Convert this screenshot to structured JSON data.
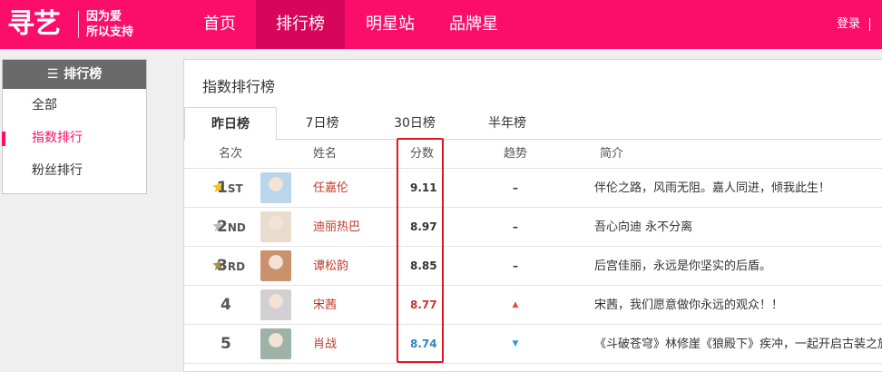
{
  "header": {
    "logo": "寻艺",
    "slogan_line1": "因为爱",
    "slogan_line2": "所以支持",
    "nav": [
      "首页",
      "排行榜",
      "明星站",
      "品牌星"
    ],
    "active_nav": 1,
    "login": "登录",
    "brand_color": "#fb0e6a"
  },
  "sidebar": {
    "title": "排行榜",
    "title_icon": "list-icon",
    "items": [
      "全部",
      "指数排行",
      "粉丝排行"
    ],
    "active_item": 1
  },
  "main": {
    "title": "指数排行榜",
    "tabs": [
      "昨日榜",
      "7日榜",
      "30日榜",
      "半年榜"
    ],
    "active_tab": 0,
    "columns": [
      "名次",
      "姓名",
      "分数",
      "趋势",
      "简介"
    ],
    "rows": [
      {
        "rank": "1ST",
        "medal": "gold-star-icon",
        "name": "任嘉伦",
        "score": "9.11",
        "trend": "flat",
        "trend_symbol": "–",
        "intro": "伴伦之路，风雨无阻。嘉人同进，倾我此生！",
        "avatar_color": "#b9d6ec"
      },
      {
        "rank": "2ND",
        "medal": "silver-star-icon",
        "name": "迪丽热巴",
        "score": "8.97",
        "trend": "flat",
        "trend_symbol": "–",
        "intro": "吾心向迪 永不分离",
        "avatar_color": "#e8dccd"
      },
      {
        "rank": "3RD",
        "medal": "bronze-star-icon",
        "name": "谭松韵",
        "score": "8.85",
        "trend": "flat",
        "trend_symbol": "–",
        "intro": "后宫佳丽，永远是你坚实的后盾。",
        "avatar_color": "#c9926c"
      },
      {
        "rank": "4",
        "medal": "",
        "name": "宋茜",
        "score": "8.77",
        "trend": "up",
        "trend_symbol": "▲",
        "intro": "宋茜，我们愿意做你永远的观众！！",
        "avatar_color": "#d3d0d3"
      },
      {
        "rank": "5",
        "medal": "",
        "name": "肖战",
        "score": "8.74",
        "trend": "down",
        "trend_symbol": "▼",
        "intro": "《斗破苍穹》林修崖《狼殿下》疾冲，一起开启古装之旅",
        "avatar_color": "#9fb2a8"
      }
    ],
    "colors": {
      "name": "#c0392b",
      "score_up": "#c0392b",
      "score_down": "#2e86c1",
      "trend_up": "#e74c3c",
      "trend_down": "#3498db",
      "gold": "#f5c518",
      "silver": "#bdbdbd",
      "bronze": "#a89055",
      "highlight": "#e4161d"
    }
  }
}
